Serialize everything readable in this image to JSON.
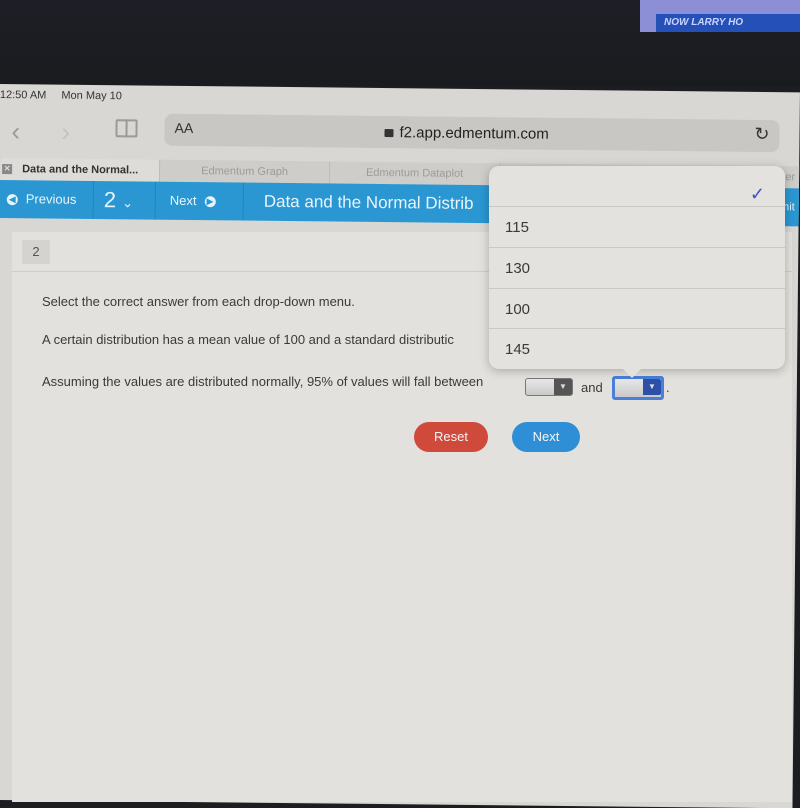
{
  "background": {
    "tv_banner_text": "NOW LARRY HO"
  },
  "status_bar": {
    "time": "12:50 AM",
    "date": "Mon May 10"
  },
  "browser": {
    "text_size_label": "AA",
    "url": "f2.app.edmentum.com",
    "tabs": [
      {
        "label": "Data and the Normal...",
        "active": true
      },
      {
        "label": "Edmentum Graph",
        "active": false
      },
      {
        "label": "Edmentum Dataplot",
        "active": false
      },
      {
        "label": "per",
        "active": false
      }
    ]
  },
  "nav": {
    "previous_label": "Previous",
    "question_number": "2",
    "next_label": "Next",
    "title": "Data and the Normal Distrib",
    "submit_fragment": "mit"
  },
  "question": {
    "number": "2",
    "instruction": "Select the correct answer from each drop-down menu.",
    "sentence1": "A certain distribution has a mean value of 100 and a standard distributic",
    "sentence2_prefix": "Assuming the values are distributed normally, 95% of values will fall between",
    "connector": "and",
    "sentence2_suffix": ".",
    "dropdown1_value": "",
    "dropdown2_value": ""
  },
  "buttons": {
    "reset": "Reset",
    "next": "Next"
  },
  "dropdown_menu": {
    "selected": "",
    "options": [
      "",
      "115",
      "130",
      "100",
      "145"
    ]
  },
  "colors": {
    "nav_blue": "#2a97d2",
    "reset_red": "#cf4a3b",
    "next_blue": "#2e8fd6",
    "check_blue": "#3a55c7"
  }
}
